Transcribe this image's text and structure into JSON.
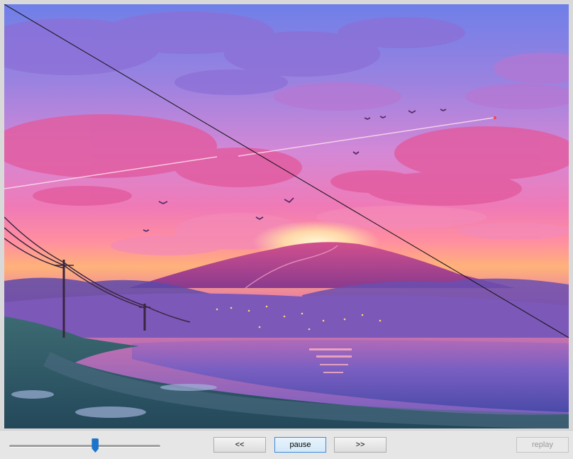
{
  "player": {
    "prev_label": "<<",
    "pause_label": "pause",
    "next_label": ">>",
    "replay_label": "replay",
    "progress": 0.57
  },
  "scene": {
    "colors": {
      "sky_top": "#5d7fe0",
      "sky_mid": "#c985d8",
      "sky_low": "#f27bb0",
      "horizon": "#ffb06e",
      "mountain": "#b53d8a",
      "lake": "#6d5fc2",
      "shore": "#2f5c6c"
    }
  }
}
